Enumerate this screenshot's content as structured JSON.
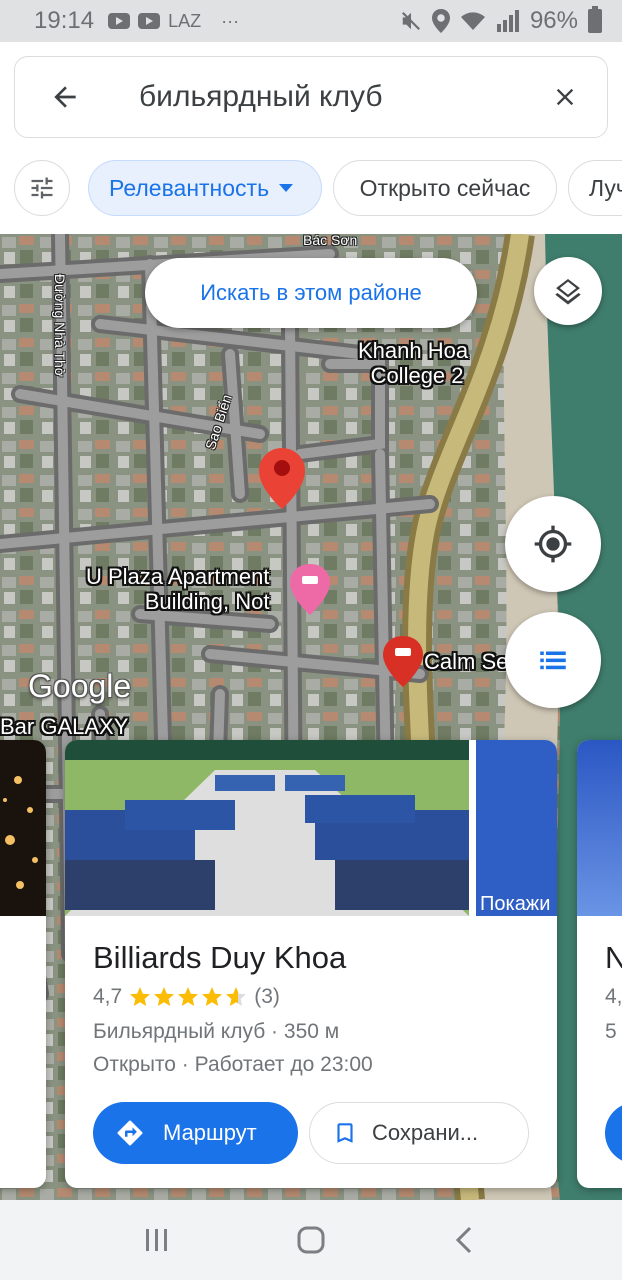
{
  "status_bar": {
    "time": "19:14",
    "app_label": "LAZ",
    "more": "···",
    "battery": "96%"
  },
  "search": {
    "query": "бильярдный клуб"
  },
  "chips": {
    "relevance": "Релевантность",
    "open_now": "Открыто сейчас",
    "best": "Лучшие"
  },
  "map": {
    "search_area_button": "Искать в этом районе",
    "labels": {
      "bac_son": "Bác Sơn",
      "duong_nha_tho": "Đường Nhà Thờ",
      "sao_bien": "Sao Biển",
      "khanh_hoa_line1": "Khanh Hoa",
      "khanh_hoa_line2": "College 2",
      "u_plaza_line1": "U Plaza Apartment",
      "u_plaza_line2": "Building, Not",
      "calm_sea": "Calm Se",
      "bar_galaxy": "Bar GALAXY",
      "google": "Google"
    }
  },
  "card": {
    "side_photo_label": "Покажи",
    "title": "Billiards Duy Khoa",
    "rating_value": "4,7",
    "rating_stars": 4.7,
    "reviews": "(3)",
    "category_distance": "Бильярдный клуб · 350 м",
    "hours": "Открыто · Работает до 23:00",
    "route_label": "Маршрут",
    "save_label": "Сохрани..."
  },
  "right_card": {
    "title_initial": "N",
    "rating_fragment": "4,",
    "line_fragment": "5"
  },
  "colors": {
    "accent": "#1a73e8",
    "star": "#fbbc04",
    "pin": "#ea4335"
  }
}
